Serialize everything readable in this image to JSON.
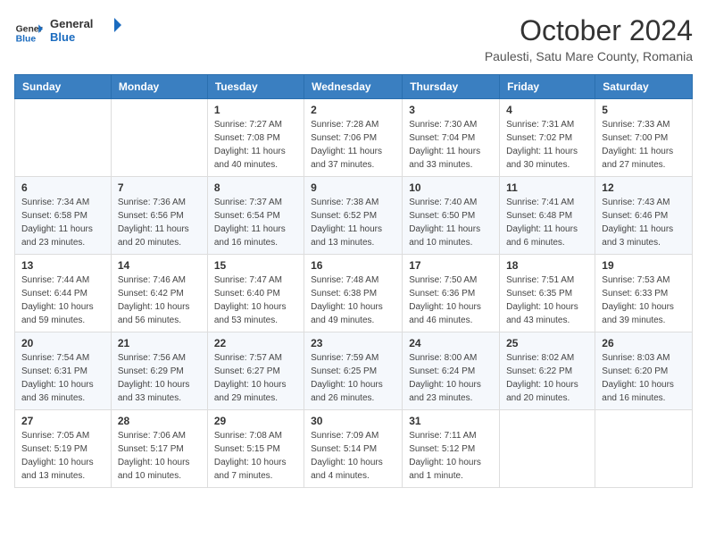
{
  "header": {
    "logo": {
      "line1": "General",
      "line2": "Blue"
    },
    "title": "October 2024",
    "location": "Paulesti, Satu Mare County, Romania"
  },
  "days_of_week": [
    "Sunday",
    "Monday",
    "Tuesday",
    "Wednesday",
    "Thursday",
    "Friday",
    "Saturday"
  ],
  "weeks": [
    {
      "days": [
        {
          "num": "",
          "info": ""
        },
        {
          "num": "",
          "info": ""
        },
        {
          "num": "1",
          "info": "Sunrise: 7:27 AM\nSunset: 7:08 PM\nDaylight: 11 hours and 40 minutes."
        },
        {
          "num": "2",
          "info": "Sunrise: 7:28 AM\nSunset: 7:06 PM\nDaylight: 11 hours and 37 minutes."
        },
        {
          "num": "3",
          "info": "Sunrise: 7:30 AM\nSunset: 7:04 PM\nDaylight: 11 hours and 33 minutes."
        },
        {
          "num": "4",
          "info": "Sunrise: 7:31 AM\nSunset: 7:02 PM\nDaylight: 11 hours and 30 minutes."
        },
        {
          "num": "5",
          "info": "Sunrise: 7:33 AM\nSunset: 7:00 PM\nDaylight: 11 hours and 27 minutes."
        }
      ]
    },
    {
      "days": [
        {
          "num": "6",
          "info": "Sunrise: 7:34 AM\nSunset: 6:58 PM\nDaylight: 11 hours and 23 minutes."
        },
        {
          "num": "7",
          "info": "Sunrise: 7:36 AM\nSunset: 6:56 PM\nDaylight: 11 hours and 20 minutes."
        },
        {
          "num": "8",
          "info": "Sunrise: 7:37 AM\nSunset: 6:54 PM\nDaylight: 11 hours and 16 minutes."
        },
        {
          "num": "9",
          "info": "Sunrise: 7:38 AM\nSunset: 6:52 PM\nDaylight: 11 hours and 13 minutes."
        },
        {
          "num": "10",
          "info": "Sunrise: 7:40 AM\nSunset: 6:50 PM\nDaylight: 11 hours and 10 minutes."
        },
        {
          "num": "11",
          "info": "Sunrise: 7:41 AM\nSunset: 6:48 PM\nDaylight: 11 hours and 6 minutes."
        },
        {
          "num": "12",
          "info": "Sunrise: 7:43 AM\nSunset: 6:46 PM\nDaylight: 11 hours and 3 minutes."
        }
      ]
    },
    {
      "days": [
        {
          "num": "13",
          "info": "Sunrise: 7:44 AM\nSunset: 6:44 PM\nDaylight: 10 hours and 59 minutes."
        },
        {
          "num": "14",
          "info": "Sunrise: 7:46 AM\nSunset: 6:42 PM\nDaylight: 10 hours and 56 minutes."
        },
        {
          "num": "15",
          "info": "Sunrise: 7:47 AM\nSunset: 6:40 PM\nDaylight: 10 hours and 53 minutes."
        },
        {
          "num": "16",
          "info": "Sunrise: 7:48 AM\nSunset: 6:38 PM\nDaylight: 10 hours and 49 minutes."
        },
        {
          "num": "17",
          "info": "Sunrise: 7:50 AM\nSunset: 6:36 PM\nDaylight: 10 hours and 46 minutes."
        },
        {
          "num": "18",
          "info": "Sunrise: 7:51 AM\nSunset: 6:35 PM\nDaylight: 10 hours and 43 minutes."
        },
        {
          "num": "19",
          "info": "Sunrise: 7:53 AM\nSunset: 6:33 PM\nDaylight: 10 hours and 39 minutes."
        }
      ]
    },
    {
      "days": [
        {
          "num": "20",
          "info": "Sunrise: 7:54 AM\nSunset: 6:31 PM\nDaylight: 10 hours and 36 minutes."
        },
        {
          "num": "21",
          "info": "Sunrise: 7:56 AM\nSunset: 6:29 PM\nDaylight: 10 hours and 33 minutes."
        },
        {
          "num": "22",
          "info": "Sunrise: 7:57 AM\nSunset: 6:27 PM\nDaylight: 10 hours and 29 minutes."
        },
        {
          "num": "23",
          "info": "Sunrise: 7:59 AM\nSunset: 6:25 PM\nDaylight: 10 hours and 26 minutes."
        },
        {
          "num": "24",
          "info": "Sunrise: 8:00 AM\nSunset: 6:24 PM\nDaylight: 10 hours and 23 minutes."
        },
        {
          "num": "25",
          "info": "Sunrise: 8:02 AM\nSunset: 6:22 PM\nDaylight: 10 hours and 20 minutes."
        },
        {
          "num": "26",
          "info": "Sunrise: 8:03 AM\nSunset: 6:20 PM\nDaylight: 10 hours and 16 minutes."
        }
      ]
    },
    {
      "days": [
        {
          "num": "27",
          "info": "Sunrise: 7:05 AM\nSunset: 5:19 PM\nDaylight: 10 hours and 13 minutes."
        },
        {
          "num": "28",
          "info": "Sunrise: 7:06 AM\nSunset: 5:17 PM\nDaylight: 10 hours and 10 minutes."
        },
        {
          "num": "29",
          "info": "Sunrise: 7:08 AM\nSunset: 5:15 PM\nDaylight: 10 hours and 7 minutes."
        },
        {
          "num": "30",
          "info": "Sunrise: 7:09 AM\nSunset: 5:14 PM\nDaylight: 10 hours and 4 minutes."
        },
        {
          "num": "31",
          "info": "Sunrise: 7:11 AM\nSunset: 5:12 PM\nDaylight: 10 hours and 1 minute."
        },
        {
          "num": "",
          "info": ""
        },
        {
          "num": "",
          "info": ""
        }
      ]
    }
  ]
}
